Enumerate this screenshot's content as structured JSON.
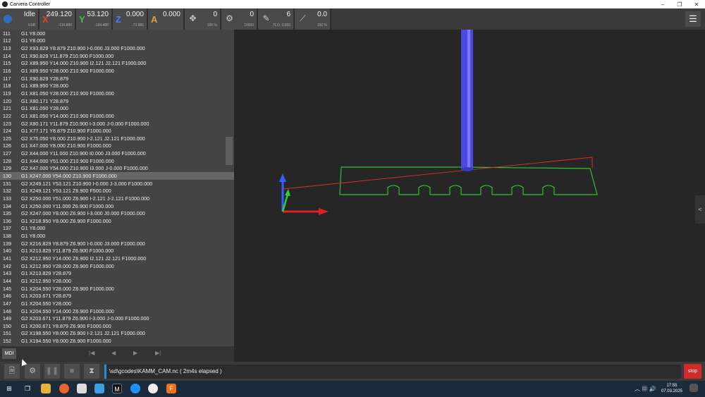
{
  "window": {
    "title": "Carvera Controller",
    "minimize": "–",
    "maximize": "❐",
    "close": "✕"
  },
  "status": {
    "state": "Idle",
    "connection": "USB",
    "x": {
      "label": "X",
      "value": "249.120",
      "sub": "-110.880",
      "color": "#e04040"
    },
    "y": {
      "label": "Y",
      "value": "53.120",
      "sub": "-184.480",
      "color": "#40c040"
    },
    "z": {
      "label": "Z",
      "value": "0.000",
      "sub": "-73.986",
      "color": "#4080ff"
    },
    "a": {
      "label": "A",
      "value": "0.000",
      "sub": "",
      "color": "#e0a030"
    },
    "feed": {
      "value": "0",
      "sub": "100 %"
    },
    "spindle": {
      "value": "0",
      "sub": "10000"
    },
    "tool": {
      "value": "6",
      "sub": "TLO: 0.000"
    },
    "laser": {
      "value": "0.0",
      "sub": "100 %"
    }
  },
  "gcode_lines": [
    {
      "n": "111",
      "code": "G1 Y8.000"
    },
    {
      "n": "112",
      "code": "G1 Y8.000"
    },
    {
      "n": "113",
      "code": "G2 X93.829 Y8.879 Z10.900 I-0.000 J3.000 F1000.000"
    },
    {
      "n": "114",
      "code": "G1 X90.829 Y11.879 Z10.900 F1000.000"
    },
    {
      "n": "115",
      "code": "G2 X89.950 Y14.000 Z10.900 I2.121 J2.121 F1000.000"
    },
    {
      "n": "116",
      "code": "G1 X89.950 Y28.000 Z10.900 F1000.000"
    },
    {
      "n": "117",
      "code": "G1 X90.829 Y28.879"
    },
    {
      "n": "118",
      "code": "G1 X89.950 Y28.000"
    },
    {
      "n": "119",
      "code": "G1 X81.050 Y28.000 Z10.900 F1000.000"
    },
    {
      "n": "120",
      "code": "G1 X80.171 Y28.879"
    },
    {
      "n": "121",
      "code": "G1 X81.050 Y28.000"
    },
    {
      "n": "122",
      "code": "G1 X81.050 Y14.000 Z10.900 F1000.000"
    },
    {
      "n": "123",
      "code": "G2 X80.171 Y11.879 Z10.900 I-3.000 J-0.000 F1000.000"
    },
    {
      "n": "124",
      "code": "G1 X77.171 Y8.879 Z10.900 F1000.000"
    },
    {
      "n": "125",
      "code": "G2 X75.050 Y8.000 Z10.900 I-2.121 J2.121 F1000.000"
    },
    {
      "n": "126",
      "code": "G1 X47.000 Y8.000 Z10.900 F1000.000"
    },
    {
      "n": "127",
      "code": "G2 X44.000 Y11.000 Z10.900 I0.000 J3.000 F1000.000"
    },
    {
      "n": "128",
      "code": "G1 X44.000 Y51.000 Z10.900 F1000.000"
    },
    {
      "n": "129",
      "code": "G2 X47.000 Y54.000 Z10.900 I3.000 J-0.000 F1000.000"
    },
    {
      "n": "130",
      "code": "G1 X247.000 Y54.000 Z10.900 F1000.000",
      "active": true
    },
    {
      "n": "131",
      "code": "G2 X249.121 Y53.121 Z10.900 I-0.000 J-3.000 F1000.000"
    },
    {
      "n": "132",
      "code": "G1 X249.121 Y53.121 Z6.900 F500.000"
    },
    {
      "n": "133",
      "code": "G2 X250.000 Y51.000 Z6.900 I-2.121 J-2.121 F1000.000"
    },
    {
      "n": "134",
      "code": "G1 X250.000 Y11.000 Z6.900 F1000.000"
    },
    {
      "n": "135",
      "code": "G2 X247.000 Y8.000 Z6.900 I-3.000 J0.000 F1000.000"
    },
    {
      "n": "136",
      "code": "G1 X218.950 Y8.000 Z6.900 F1000.000"
    },
    {
      "n": "137",
      "code": "G1 Y8.000"
    },
    {
      "n": "138",
      "code": "G1 Y8.000"
    },
    {
      "n": "139",
      "code": "G2 X216.829 Y8.879 Z6.900 I-0.000 J3.000 F1000.000"
    },
    {
      "n": "140",
      "code": "G1 X213.829 Y11.879 Z6.900 F1000.000"
    },
    {
      "n": "141",
      "code": "G2 X212.950 Y14.000 Z6.900 I2.121 J2.121 F1000.000"
    },
    {
      "n": "142",
      "code": "G1 X212.950 Y28.000 Z6.900 F1000.000"
    },
    {
      "n": "143",
      "code": "G1 X213.829 Y28.879"
    },
    {
      "n": "144",
      "code": "G1 X212.950 Y28.000"
    },
    {
      "n": "145",
      "code": "G1 X204.550 Y28.000 Z6.900 F1000.000"
    },
    {
      "n": "146",
      "code": "G1 X203.671 Y28.879"
    },
    {
      "n": "147",
      "code": "G1 X204.550 Y28.000"
    },
    {
      "n": "148",
      "code": "G1 X204.550 Y14.000 Z6.900 F1000.000"
    },
    {
      "n": "149",
      "code": "G2 X203.671 Y11.879 Z6.900 I-3.000 J-0.000 F1000.000"
    },
    {
      "n": "150",
      "code": "G1 X200.671 Y8.879 Z6.900 F1000.000"
    },
    {
      "n": "151",
      "code": "G2 X198.550 Y8.000 Z6.900 I-2.121 J2.121 F1000.000"
    },
    {
      "n": "152",
      "code": "G1 X194.550 Y8.000 Z6.900 F1000.000"
    }
  ],
  "gcode_controls": {
    "mdi": "MDI",
    "first": "|◀",
    "prev": "◀",
    "next": "▶",
    "last": "▶|"
  },
  "viewport": {
    "side_tab": "<"
  },
  "file": {
    "path": "\\sd\\gcodes\\KAMM_CAM.nc ( 2m4s elapsed )"
  },
  "stop_label": "stop",
  "taskbar": {
    "time": "17:55",
    "date": "07.03.2025"
  }
}
